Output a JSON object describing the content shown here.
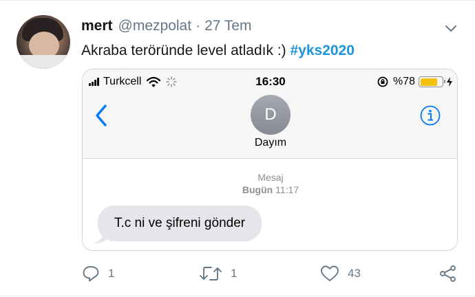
{
  "tweet": {
    "author_name": "mert",
    "handle": "@mezpolat",
    "separator": "·",
    "date": "27 Tem",
    "text": "Akraba teröründe level atladık :)",
    "hashtag": "#yks2020"
  },
  "phone": {
    "carrier": "Turkcell",
    "time": "16:30",
    "battery_text": "%78",
    "battery_level": 0.78,
    "contact_initial": "D",
    "contact_name": "Dayım",
    "message_service": "Mesaj",
    "day_label": "Bugün",
    "message_time": "11:17",
    "message_text": "T.c ni ve şifreni gönder"
  },
  "actions": {
    "replies": "1",
    "retweets": "1",
    "likes": "43"
  },
  "icons": [
    "caret-down-icon",
    "signal-icon",
    "wifi-icon",
    "loading-icon",
    "rotation-lock-icon",
    "battery-icon",
    "charging-icon",
    "back-chevron-icon",
    "info-icon",
    "reply-icon",
    "retweet-icon",
    "like-icon",
    "share-icon"
  ],
  "colors": {
    "hashtag": "#1b95e0",
    "ios_blue": "#007aff",
    "muted": "#657786",
    "bubble": "#e5e5ea",
    "battery": "#f4c20d"
  }
}
